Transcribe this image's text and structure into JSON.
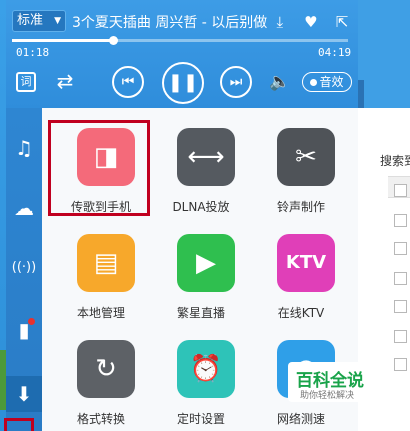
{
  "player": {
    "quality": "标准",
    "song_title": "3个夏天插曲    周兴哲 - 以后别做",
    "time_current": "01:18",
    "time_total": "04:19",
    "progress": 0.3,
    "lyric_label": "词",
    "effect_label": "音效"
  },
  "sidebar": {
    "items": [
      {
        "name": "music-icon",
        "glyph": "♫"
      },
      {
        "name": "cloud-icon",
        "glyph": "☁"
      },
      {
        "name": "radio-icon",
        "glyph": "((·))"
      },
      {
        "name": "device-icon",
        "glyph": "▮"
      },
      {
        "name": "download-icon",
        "glyph": "⬇"
      }
    ]
  },
  "tools": [
    {
      "label": "传歌到手机",
      "color": "#f46a7a",
      "glyph": "◨"
    },
    {
      "label": "DLNA投放",
      "color": "#555a60",
      "glyph": "⟷"
    },
    {
      "label": "铃声制作",
      "color": "#4f5358",
      "glyph": "✂"
    },
    {
      "label": "本地管理",
      "color": "#f7a82b",
      "glyph": "▤"
    },
    {
      "label": "繁星直播",
      "color": "#2fbf4f",
      "glyph": "▶"
    },
    {
      "label": "在线KTV",
      "color": "#e03fb8",
      "glyph": "KTV"
    },
    {
      "label": "格式转换",
      "color": "#5d6166",
      "glyph": "↻"
    },
    {
      "label": "定时设置",
      "color": "#2ec3b8",
      "glyph": "⏰"
    },
    {
      "label": "网络测速",
      "color": "#2f9fe8",
      "glyph": "◔"
    }
  ],
  "right_panel": {
    "search_label": "搜索到"
  },
  "watermark": {
    "title": "百科全说",
    "subtitle": "助你轻松解决"
  }
}
